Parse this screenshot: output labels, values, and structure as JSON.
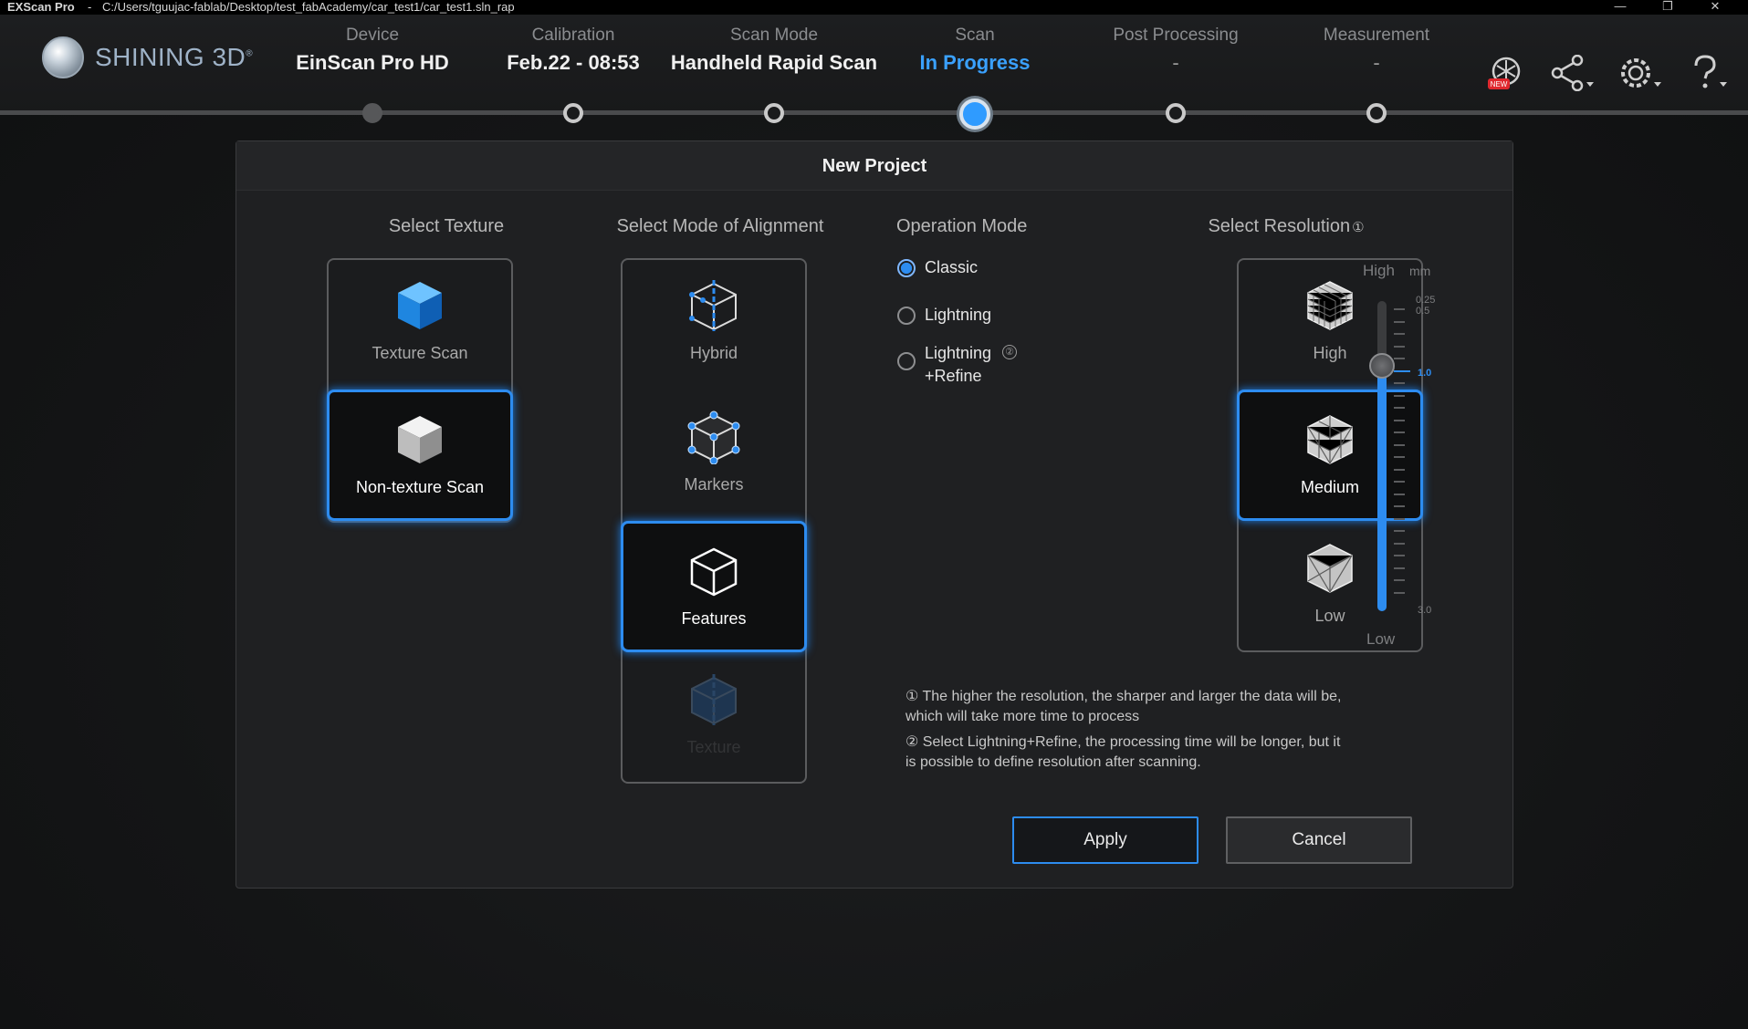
{
  "titlebar": {
    "app": "EXScan Pro",
    "separator": "-",
    "path": "C:/Users/tguujac-fablab/Desktop/test_fabAcademy/car_test1/car_test1.sln_rap",
    "minimize": "—",
    "restore": "❐",
    "close": "✕"
  },
  "brand": {
    "name": "SHINING 3D",
    "reg": "®"
  },
  "steps": [
    {
      "label": "Device",
      "value": "EinScan Pro HD"
    },
    {
      "label": "Calibration",
      "value": "Feb.22 - 08:53"
    },
    {
      "label": "Scan Mode",
      "value": "Handheld Rapid Scan"
    },
    {
      "label": "Scan",
      "value": "In Progress"
    },
    {
      "label": "Post Processing",
      "value": "-"
    },
    {
      "label": "Measurement",
      "value": "-"
    }
  ],
  "header_icons": [
    "new-badge-icon",
    "share-icon",
    "gear-icon",
    "help-icon"
  ],
  "new_badge": "NEW",
  "dialog": {
    "title": "New Project",
    "texture": {
      "title": "Select Texture",
      "options": [
        "Texture Scan",
        "Non-texture Scan"
      ],
      "selected": "Non-texture Scan"
    },
    "alignment": {
      "title": "Select Mode of Alignment",
      "options": [
        "Hybrid",
        "Markers",
        "Features",
        "Texture"
      ],
      "selected": "Features"
    },
    "operation": {
      "title": "Operation Mode",
      "options": [
        "Classic",
        "Lightning",
        "Lightning\n+Refine"
      ],
      "lightning_refine_line1": "Lightning",
      "lightning_refine_line2": "+Refine",
      "info_marker": "②",
      "selected": "Classic"
    },
    "resolution": {
      "title": "Select Resolution",
      "title_marker": "①",
      "options": [
        "High",
        "Medium",
        "Low"
      ],
      "selected": "Medium",
      "slider_top_label": "High",
      "slider_unit": "mm",
      "slider_bottom_label": "Low",
      "tick_025": "0.25",
      "tick_05": "0.5",
      "current_value": "1.0",
      "tick_3": "3.0",
      "value_fraction": 0.79
    },
    "notes": {
      "note1": "① The higher the resolution, the sharper and larger the data will be, which will take more time to process",
      "note2": "② Select Lightning+Refine, the processing time will be longer, but it is possible to define resolution after scanning."
    },
    "apply": "Apply",
    "cancel": "Cancel"
  },
  "colors": {
    "accent": "#2d8cf0",
    "active_step": "#3aa1ff",
    "panel_border": "#5b5c5e"
  }
}
